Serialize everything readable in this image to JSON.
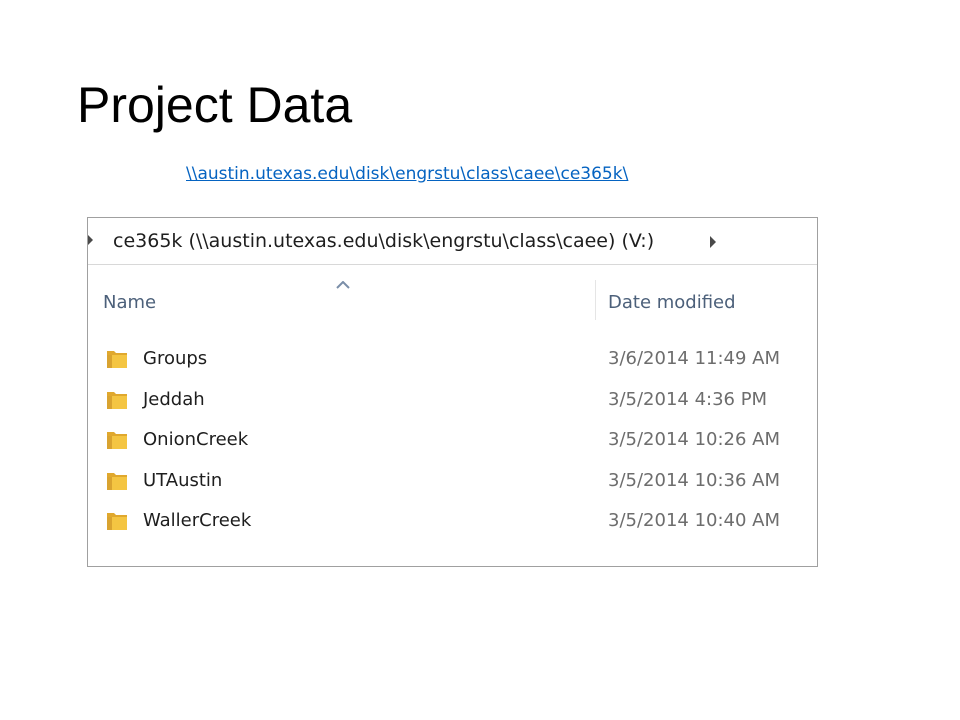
{
  "slide": {
    "title": "Project Data",
    "link_text": "\\\\austin.utexas.edu\\disk\\engrstu\\class\\caee\\ce365k\\"
  },
  "explorer": {
    "address": "ce365k (\\\\austin.utexas.edu\\disk\\engrstu\\class\\caee) (V:)",
    "columns": {
      "name": "Name",
      "date_modified": "Date modified"
    },
    "sort": {
      "column": "name",
      "direction": "ascending"
    },
    "rows": [
      {
        "name": "Groups",
        "date": "3/6/2014 11:49 AM",
        "icon": "folder-icon"
      },
      {
        "name": "Jeddah",
        "date": "3/5/2014 4:36 PM",
        "icon": "folder-icon"
      },
      {
        "name": "OnionCreek",
        "date": "3/5/2014 10:26 AM",
        "icon": "folder-icon"
      },
      {
        "name": "UTAustin",
        "date": "3/5/2014 10:36 AM",
        "icon": "folder-icon"
      },
      {
        "name": "WallerCreek",
        "date": "3/5/2014 10:40 AM",
        "icon": "folder-icon"
      }
    ]
  },
  "colors": {
    "link": "#0563c1",
    "header_text": "#4c607a",
    "folder_yellow": "#f4c542"
  }
}
